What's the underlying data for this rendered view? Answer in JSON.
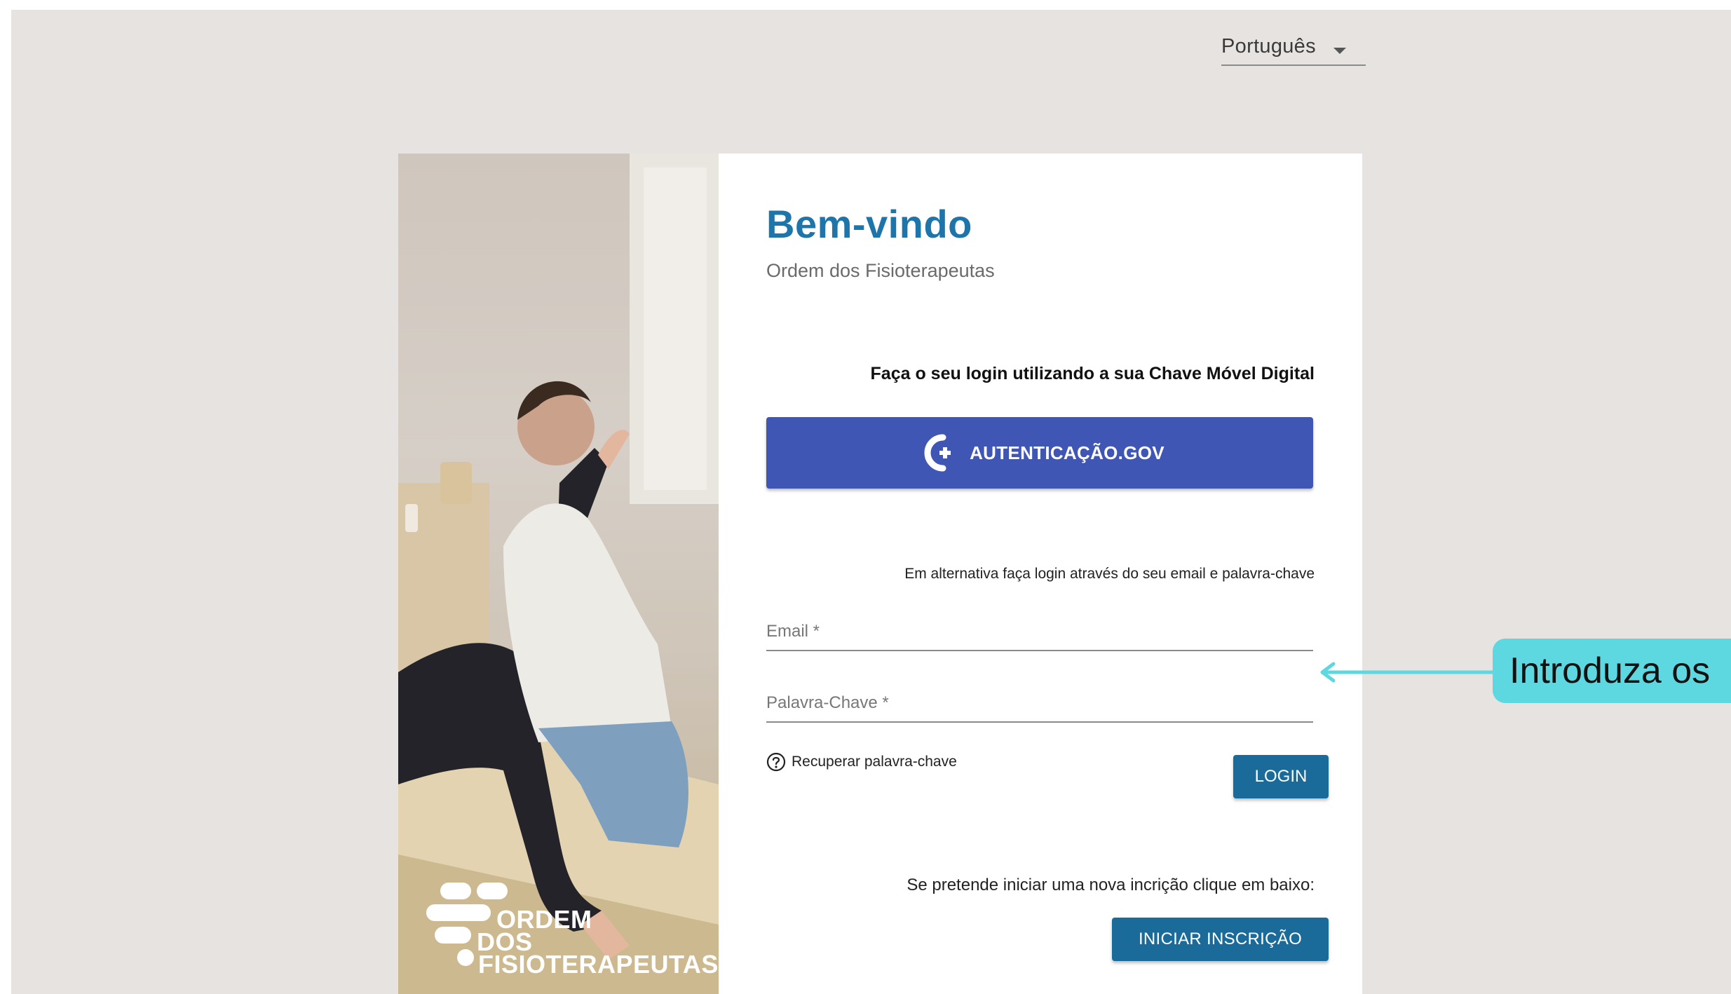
{
  "header": {
    "language": {
      "selected": "Português"
    }
  },
  "brand": {
    "logo_lines": [
      "ORDEM",
      "DOS",
      "FISIOTERAPEUTAS"
    ]
  },
  "welcome": {
    "title": "Bem-vindo",
    "subtitle": "Ordem dos Fisioterapeutas"
  },
  "cmd": {
    "prompt": "Faça o seu login utilizando a sua Chave Móvel Digital",
    "button_label": "AUTENTICAÇÃO.GOV"
  },
  "login": {
    "alt_prompt": "Em alternativa faça login através do seu email e palavra-chave",
    "email_placeholder": "Email *",
    "password_placeholder": "Palavra-Chave *",
    "recover_label": "Recuperar palavra-chave",
    "login_label": "LOGIN"
  },
  "signup": {
    "prompt": "Se pretende iniciar uma nova incrição clique em baixo:",
    "button_label": "INICIAR INSCRIÇÃO"
  },
  "annotation": {
    "text": "Introduza os"
  },
  "colors": {
    "page_bg": "#e6e3e1",
    "title_blue": "#1d75aa",
    "gov_button": "#4056b4",
    "primary_button": "#1a6b9a",
    "callout": "#5ed8e0"
  },
  "icons": [
    "chevron-down-icon",
    "autenticacao-gov-icon",
    "help-circle-icon",
    "arrow-left-icon"
  ]
}
